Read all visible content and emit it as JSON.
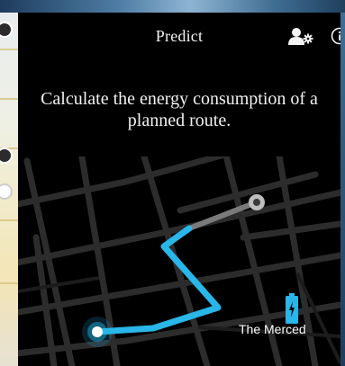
{
  "header": {
    "title": "Predict",
    "profile_icon": "profile-settings-icon",
    "info_icon": "info-icon"
  },
  "main": {
    "headline": "Calculate the energy consumption of a planned route.",
    "battery_icon": "battery-icon",
    "caption": "The Merced"
  },
  "colors": {
    "panel_background": "#000000",
    "route": "#29b6e8",
    "route_inactive": "#7a7a7a",
    "battery": "#29b6e8",
    "text": "#f2f2f2"
  }
}
